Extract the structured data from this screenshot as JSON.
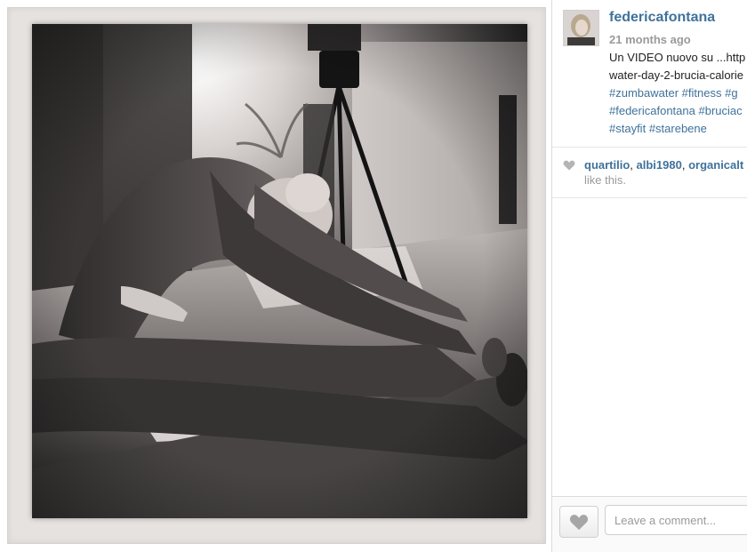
{
  "post": {
    "photo_alt": "Black and white photo of a woman stretching on a mat, camera on tripod in background",
    "username": "federicafontana",
    "time_ago": "21 months ago",
    "caption_lines": [
      "Un VIDEO nuovo su ...http",
      "water-day-2-brucia-calorie"
    ],
    "hashtag_lines": [
      [
        "#zumbawater",
        "#fitness",
        "#g"
      ],
      [
        "#federicafontana",
        "#bruciac"
      ],
      [
        "#stayfit",
        "#starebene"
      ]
    ]
  },
  "likes": {
    "users": [
      "quartilio",
      "albi1980",
      "organicalt"
    ],
    "suffix": "like this.",
    "heart_icon": "heart-icon"
  },
  "comment": {
    "placeholder": "Leave a comment...",
    "like_button_icon": "heart-icon"
  },
  "colors": {
    "link": "#3f729b",
    "muted": "#9a9a9a",
    "frame": "#e6e2e0"
  }
}
